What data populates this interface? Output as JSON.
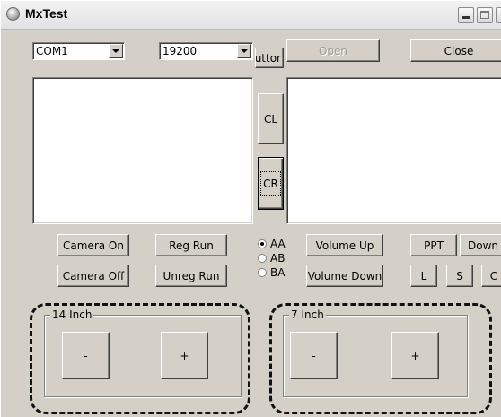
{
  "window": {
    "title": "MxTest"
  },
  "port": {
    "selected": "COM1"
  },
  "baud": {
    "selected": "19200"
  },
  "buttons": {
    "clipped": "uttor",
    "open": "Open",
    "close": "Close",
    "cl": "CL",
    "cr": "CR",
    "camera_on": "Camera On",
    "camera_off": "Camera Off",
    "reg_run": "Reg Run",
    "unreg_run": "Unreg Run",
    "volume_up": "Volume Up",
    "volume_down": "Volume Down",
    "ppt": "PPT",
    "down": "Down",
    "l": "L",
    "s": "S",
    "c": "C"
  },
  "radios": [
    {
      "label": "AA",
      "checked": true
    },
    {
      "label": "AB",
      "checked": false
    },
    {
      "label": "BA",
      "checked": false
    }
  ],
  "groups": {
    "inch14": {
      "label": "14 Inch",
      "minus": "-",
      "plus": "+"
    },
    "inch7": {
      "label": "7 Inch",
      "minus": "-",
      "plus": "+"
    }
  }
}
